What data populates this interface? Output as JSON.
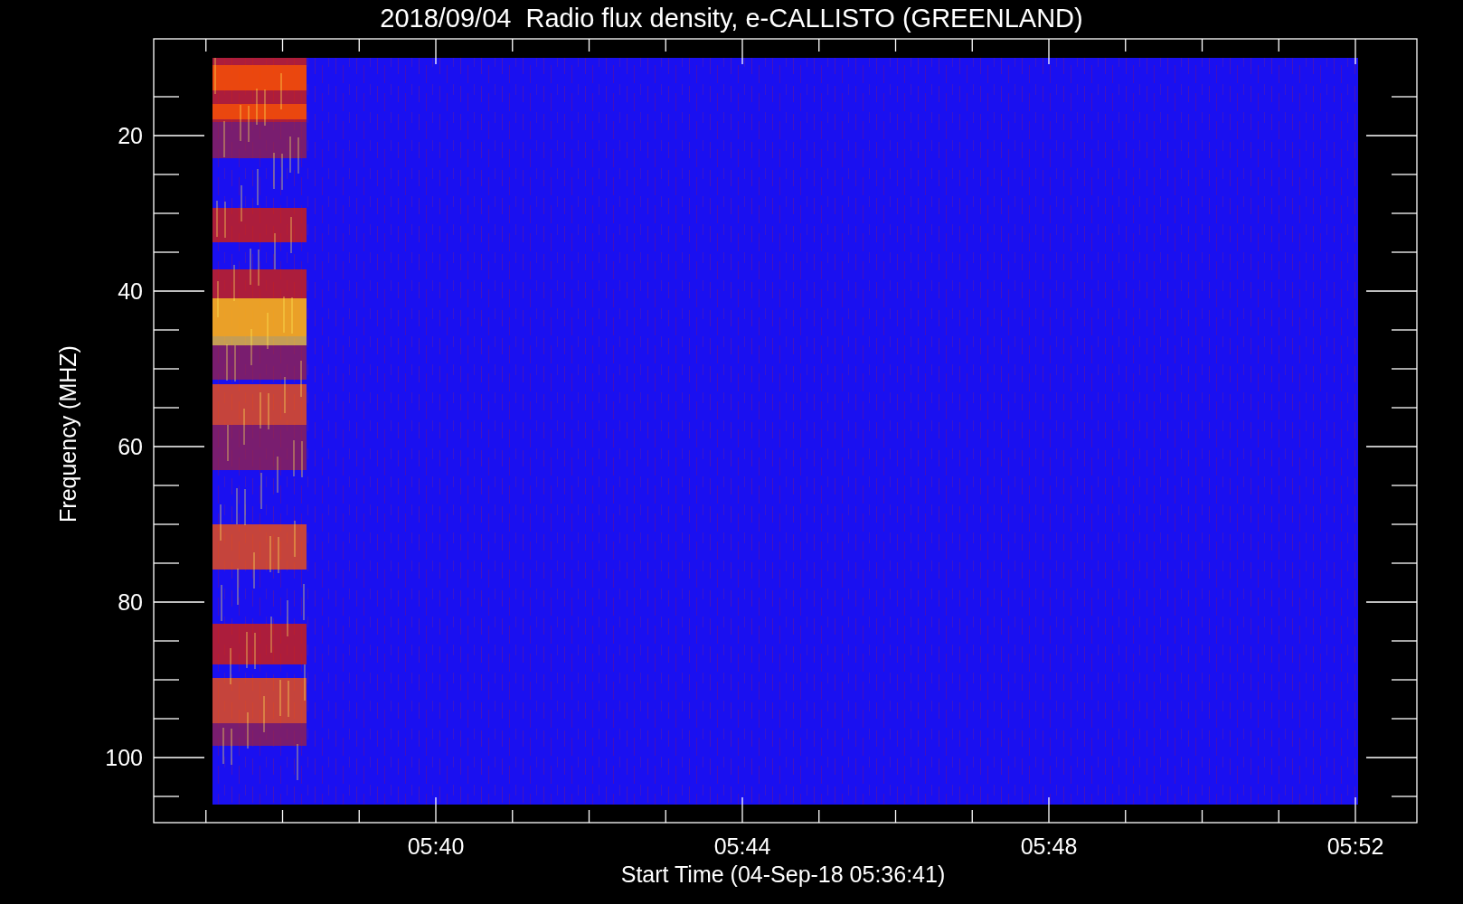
{
  "title": "2018/09/04  Radio flux density, e-CALLISTO (GREENLAND)",
  "y_axis": {
    "label": "Frequency (MHZ)",
    "ticks": [
      "20",
      "40",
      "60",
      "80",
      "100"
    ]
  },
  "x_axis": {
    "label": "Start Time (04-Sep-18 05:36:41)",
    "ticks": [
      "05:40",
      "05:44",
      "05:48",
      "05:52"
    ]
  }
}
